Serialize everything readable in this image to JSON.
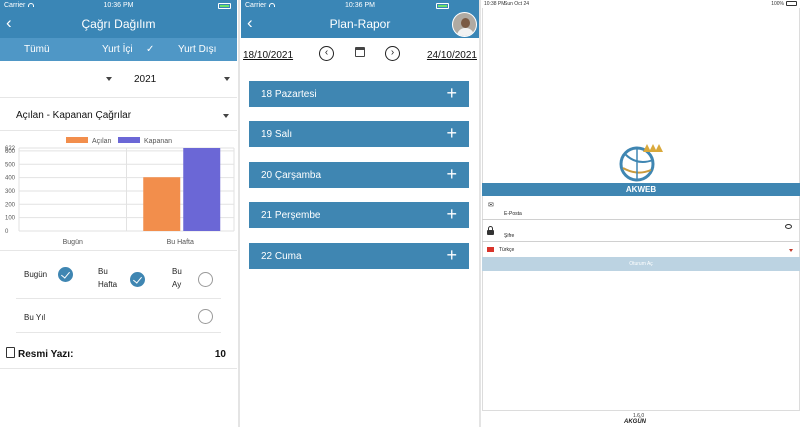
{
  "screen1": {
    "status": {
      "carrier": "Carrier",
      "time": "10:36 PM"
    },
    "title": "Çağrı Dağılım",
    "tabs": [
      {
        "label": "Tümü",
        "checked": false
      },
      {
        "label": "Yurt İçi",
        "checked": true
      },
      {
        "label": "Yurt Dışı",
        "checked": false
      }
    ],
    "check_glyph": "✓",
    "year_value": "2021",
    "report_select": "Açılan - Kapanan Çağrılar",
    "chart_data": {
      "type": "bar",
      "categories": [
        "Bugün",
        "Bu Hafta"
      ],
      "series": [
        {
          "name": "Açılan",
          "values": [
            0,
            403
          ],
          "color": "#f28e4c"
        },
        {
          "name": "Kapanan",
          "values": [
            0,
            622
          ],
          "color": "#6b67d6"
        }
      ],
      "ylim": [
        0,
        622
      ],
      "yticks": [
        "0",
        "100",
        "200",
        "300",
        "400",
        "500",
        "600",
        "622"
      ],
      "legend_position": "top"
    },
    "period_options": [
      {
        "label": "Bugün",
        "selected": true
      },
      {
        "label": "Bu\nHafta",
        "selected": true
      },
      {
        "label": "Bu\nAy",
        "selected": false
      },
      {
        "label": "Bu Yıl",
        "selected": false
      }
    ],
    "official_letter": {
      "label": "Resmi Yazı:",
      "count": "10"
    }
  },
  "screen2": {
    "status": {
      "carrier": "Carrier",
      "time": "10:36 PM"
    },
    "title": "Plan-Rapor",
    "date_start": "18/10/2021",
    "date_end": "24/10/2021",
    "prev_glyph": "‹",
    "next_glyph": "›",
    "days": [
      {
        "label": "18 Pazartesi"
      },
      {
        "label": "19 Salı"
      },
      {
        "label": "20 Çarşamba"
      },
      {
        "label": "21 Perşembe"
      },
      {
        "label": "22 Cuma"
      }
    ],
    "plus_glyph": "+"
  },
  "screen3": {
    "status": {
      "time": "10:38 PM",
      "date": "Sun Oct 24",
      "battery": "100%"
    },
    "brand": "AKWEB",
    "email_label": "E-Posta",
    "password_label": "Şifre",
    "language": "Türkçe",
    "open_session": "Oturum Aç",
    "version": "1.6.0",
    "company": "AKGÜN"
  }
}
